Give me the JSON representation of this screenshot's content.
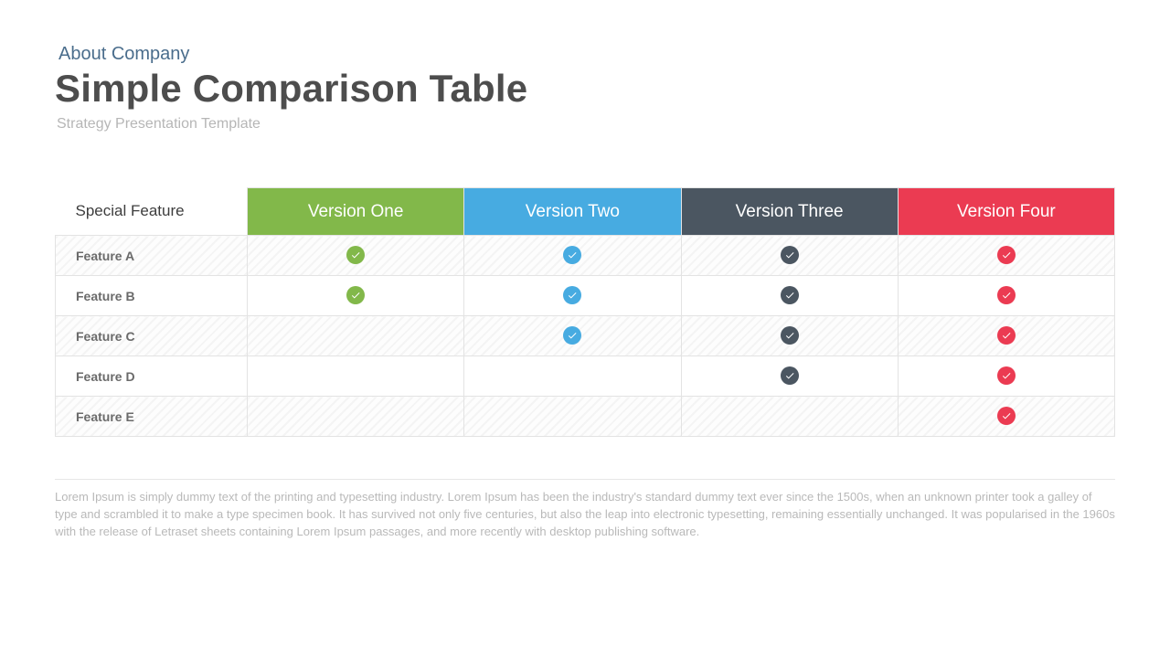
{
  "header": {
    "eyebrow": "About Company",
    "title": "Simple Comparison Table",
    "subtitle": "Strategy Presentation Template"
  },
  "table": {
    "row_header": "Special Feature",
    "columns": [
      {
        "label": "Version One"
      },
      {
        "label": "Version Two"
      },
      {
        "label": "Version Three"
      },
      {
        "label": "Version Four"
      }
    ],
    "rows": [
      {
        "label": "Feature A"
      },
      {
        "label": "Feature B"
      },
      {
        "label": "Feature C"
      },
      {
        "label": "Feature D"
      },
      {
        "label": "Feature E"
      }
    ]
  },
  "footnote": "Lorem Ipsum is simply dummy text of the printing and typesetting industry. Lorem Ipsum has been the industry's standard dummy text ever since the 1500s, when an unknown printer took a galley of type and scrambled it to make a type specimen book. It has survived not only five centuries, but also the leap into electronic typesetting, remaining essentially unchanged. It was popularised in the 1960s with the release of Letraset sheets containing Lorem Ipsum passages, and more recently with desktop publishing software.",
  "colors": {
    "green": "#82b84a",
    "blue": "#47abe1",
    "slate": "#4b5661",
    "red": "#eb3b52"
  },
  "chart_data": {
    "type": "table",
    "title": "Simple Comparison Table",
    "row_header": "Special Feature",
    "columns": [
      "Version One",
      "Version Two",
      "Version Three",
      "Version Four"
    ],
    "rows": [
      "Feature A",
      "Feature B",
      "Feature C",
      "Feature D",
      "Feature E"
    ],
    "matrix": [
      [
        true,
        true,
        true,
        true
      ],
      [
        true,
        true,
        true,
        true
      ],
      [
        false,
        true,
        true,
        true
      ],
      [
        false,
        false,
        true,
        true
      ],
      [
        false,
        false,
        false,
        true
      ]
    ],
    "column_colors": [
      "#82b84a",
      "#47abe1",
      "#4b5661",
      "#eb3b52"
    ]
  }
}
